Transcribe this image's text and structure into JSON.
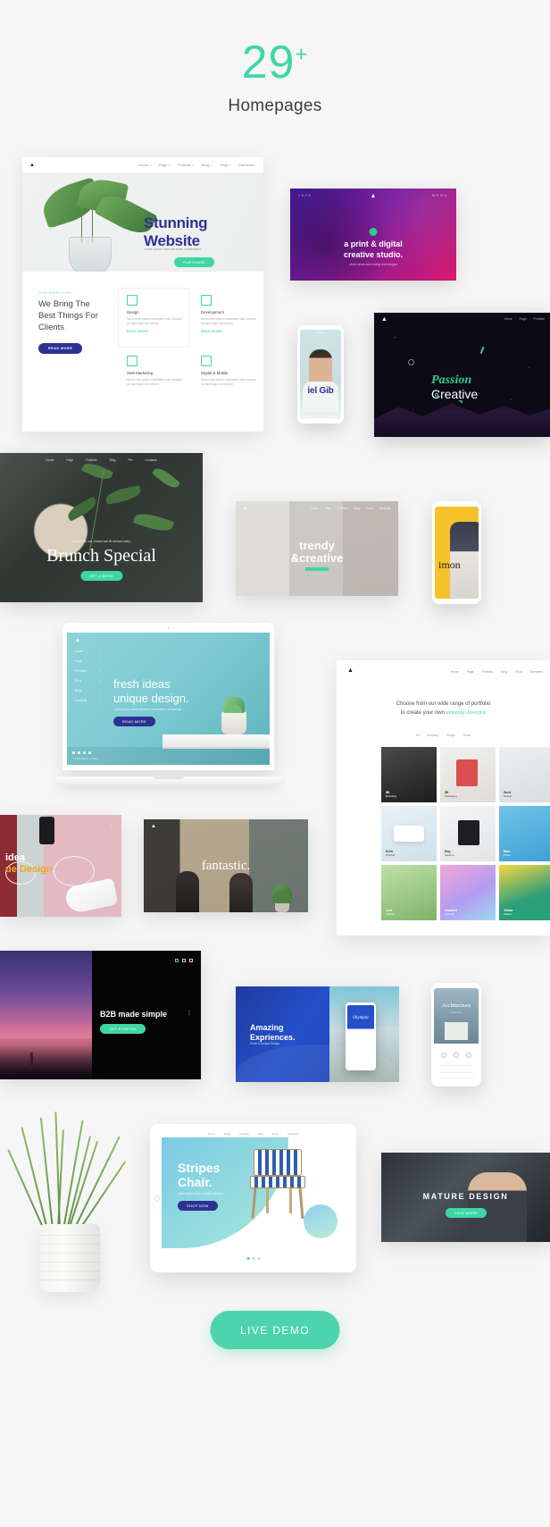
{
  "header": {
    "count": "29",
    "plus": "+",
    "subtitle": "Homepages"
  },
  "nav_items": [
    "Home",
    "Page",
    "Portfolio",
    "Blog",
    "Shop",
    "Elements"
  ],
  "stunning": {
    "logo": "M",
    "title": "Stunning\nWebsite",
    "title_line1": "Stunning",
    "title_line2": "Website",
    "subtitle": "Lorem ipsum dolor sit amet, consectetur",
    "cta": "PURCHASE",
    "section_label": "OUR SERVICES",
    "section_title": "We Bring The Best Things For Clients",
    "section_button": "READ MORE",
    "services": [
      {
        "name": "Design",
        "text": "Nemo enim ipsam voluptatem quia voluptas sit aspernatur aut odit aut",
        "more": "READ MORE"
      },
      {
        "name": "Development",
        "text": "Nemo enim ipsam voluptatem quia voluptas sit aspernatur aut odit aut",
        "more": "READ MORE"
      },
      {
        "name": "Web Marketing",
        "text": "Nemo enim ipsam voluptatem quia voluptas sit aspernatur aut odit aut",
        "more": "READ MORE"
      },
      {
        "name": "Digital & Mobile",
        "text": "Nemo enim ipsam voluptatem quia voluptas sit aspernatur aut odit aut",
        "more": "READ MORE"
      }
    ]
  },
  "print_studio": {
    "topleft": "1905",
    "topright": "MENU",
    "title_line1": "a print & digital",
    "title_line2": "creative studio.",
    "subtitle": "where ideas and exciting technologies"
  },
  "dark_creative": {
    "title_italic": "Passion",
    "title_plain": "Creative",
    "nav": [
      "Home",
      "Page",
      "Portfolio"
    ]
  },
  "phone_person": {
    "name": "iel Gib"
  },
  "brunch": {
    "nav": [
      "Home",
      "Page",
      "Portfolio",
      "Blog",
      "Pin",
      "Contacts"
    ],
    "kicker": "Check out our restaurant & menus today",
    "title": "Brunch Special",
    "cta": "GET A BOOK"
  },
  "trendy": {
    "title_line1": "trendy",
    "title_line2": "&creative"
  },
  "phone_yellow": {
    "title": "imon"
  },
  "laptop": {
    "title_line1": "fresh ideas",
    "title_line2": "unique design.",
    "subtitle": "Lorem ipsum dolor sit amet consectetur adipiscing",
    "cta": "READ MORE",
    "menu": [
      "Home",
      "Page",
      "Portfolio",
      "Shop",
      "Blog",
      "Contacts"
    ],
    "copyright": "© 2019 Mixdes - Theme"
  },
  "portfolio": {
    "head_line1": "Choose from our wide range of portfolio",
    "head_line2_plain": "to create your own ",
    "head_line2_em": "amazing showcase",
    "filters": [
      "All",
      "Branding",
      "Design",
      "Photo"
    ],
    "active_filter": "All",
    "cells": [
      {
        "title": "IBI",
        "sub": "Branding"
      },
      {
        "title": "IBI",
        "sub": "Packaging"
      },
      {
        "title": "Work",
        "sub": "Design"
      },
      {
        "title": "Rolls",
        "sub": "Product"
      },
      {
        "title": "Bag",
        "sub": "Mockup"
      },
      {
        "title": "Blue",
        "sub": "Photo"
      },
      {
        "title": "Leaf",
        "sub": "Portrait"
      },
      {
        "title": "Gradient",
        "sub": "Abstract"
      },
      {
        "title": "Yellow",
        "sub": "Pattern"
      }
    ]
  },
  "pink_card": {
    "title_line1": "idea",
    "title_line2_plain": "ue Design",
    "title_line2_dot": "."
  },
  "fantastic": {
    "title": "fantastic."
  },
  "b2b": {
    "title": "B2B made simple",
    "cta": "GET STARTED"
  },
  "amazing": {
    "title_line1": "Amazing",
    "title_line2": "Expriences.",
    "subtitle": "Fresh & Unique Design",
    "phone_word": "Olympia"
  },
  "phone_architecture": {
    "title": "Architecture",
    "subtitle": "IDEAS"
  },
  "stripes_chair": {
    "nav": [
      "Home",
      "Page",
      "Portfolio",
      "Blog",
      "Shop",
      "Contacts"
    ],
    "title_line1": "Stripes",
    "title_line2": "Chair.",
    "subtitle": "Lorem ipsum dolor sit amet laborum",
    "cta": "SHOP NOW"
  },
  "mature": {
    "title": "MATURE DESIGN",
    "cta": "VIEW MORE"
  },
  "live_demo": {
    "label": "LIVE DEMO"
  },
  "colors": {
    "mint": "#3ed6a5",
    "mint_button": "#4dd4ac",
    "deep_blue": "#2d3194",
    "page_bg": "#f6f6f6",
    "text_dark": "#3a3f45",
    "muted": "#9aa0a6"
  }
}
